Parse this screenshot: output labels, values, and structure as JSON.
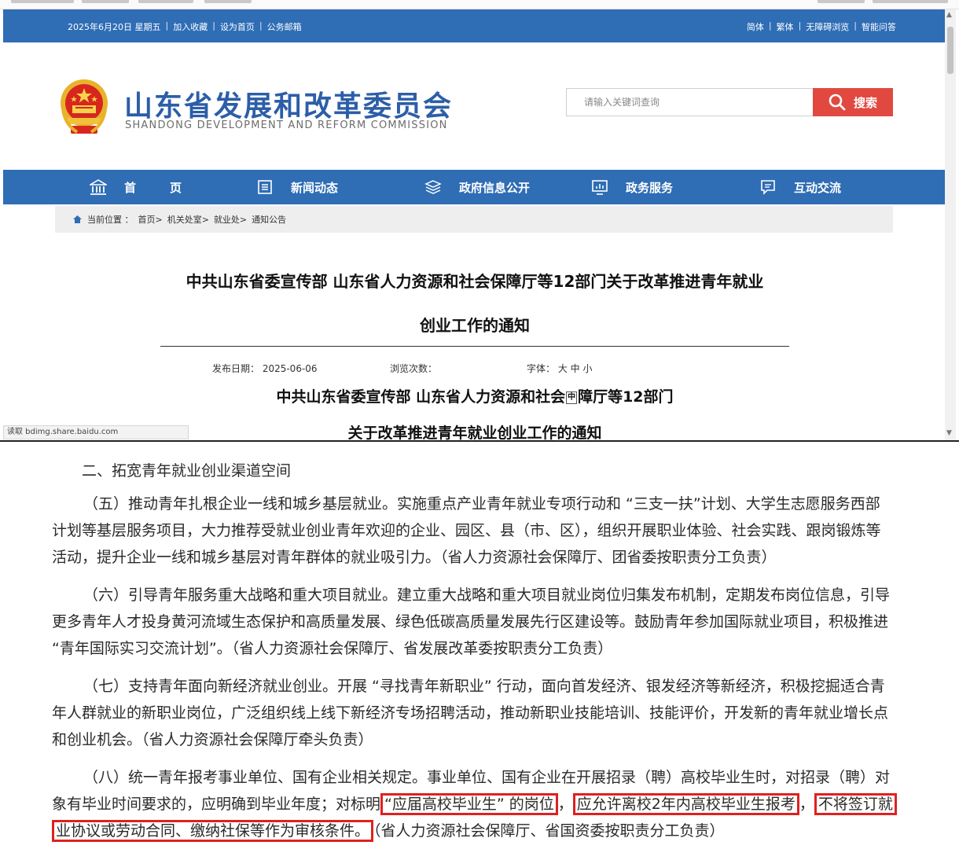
{
  "topbar": {
    "date": "2025年6月20日 星期五",
    "links_left": [
      "加入收藏",
      "设为首页",
      "公务邮箱"
    ],
    "links_right": [
      "简体",
      "繁体",
      "无障碍浏览",
      "智能问答"
    ]
  },
  "header": {
    "title": "山东省发展和改革委员会",
    "subtitle": "SHANDONG DEVELOPMENT AND REFORM COMMISSION",
    "search_placeholder": "请输入关键词查询",
    "search_button": "搜索"
  },
  "nav": {
    "items": [
      {
        "label": "首　页",
        "icon": "bank-icon"
      },
      {
        "label": "新闻动态",
        "icon": "news-icon"
      },
      {
        "label": "政府信息公开",
        "icon": "layers-icon"
      },
      {
        "label": "政务服务",
        "icon": "monitor-icon"
      },
      {
        "label": "互动交流",
        "icon": "chat-icon"
      }
    ]
  },
  "breadcrumb": {
    "prefix": "当前位置 ：",
    "items": [
      "首页>",
      "机关处室>",
      "就业处>",
      "通知公告"
    ]
  },
  "article": {
    "title_line1": "中共山东省委宣传部 山东省人力资源和社会保障厅等12部门关于改革推进青年就业",
    "title_line2": "创业工作的通知",
    "publish_date": "发布日期：  2025-06-06",
    "view_count": "浏览次数：",
    "font_size": "字体：  大 中 小",
    "sub_title_line1": "中共山东省委宣传部  山东省人力资源和社会",
    "sub_title_line1_tail": "障厅等12部门",
    "sub_title_line2": "关于改革推进青年就业创业工作的通知"
  },
  "statusbar": {
    "text": "读取 bdimg.share.baidu.com"
  },
  "content": {
    "section_heading": "二、拓宽青年就业创业渠道空间",
    "p5": [
      "（五）推动青年扎根企业一线和城乡基层就业。实施重点产业青年就业专项行动和 “三支一扶”计划、大学生志愿服务西部",
      "计划等基层服务项目，大力推荐受就业创业青年欢迎的企业、园区、县（市、区），组织开展职业体验、社会实践、跟岗锻炼等",
      "活动，提升企业一线和城乡基层对青年群体的就业吸引力。（省人力资源社会保障厅、团省委按职责分工负责）"
    ],
    "p6": [
      "（六）引导青年服务重大战略和重大项目就业。建立重大战略和重大项目就业岗位归集发布机制，定期发布岗位信息，引导",
      "更多青年人才投身黄河流域生态保护和高质量发展、绿色低碳高质量发展先行区建设等。鼓励青年参加国际就业项目，积极推进",
      "“青年国际实习交流计划”。（省人力资源社会保障厅、省发展改革委按职责分工负责）"
    ],
    "p7": [
      "（七）支持青年面向新经济就业创业。开展 “寻找青年新职业” 行动，面向首发经济、银发经济等新经济，积极挖掘适合青",
      "年人群就业的新职业岗位，广泛组织线上线下新经济专场招聘活动，推动新职业技能培训、技能评价，开发新的青年就业增长点",
      "和创业机会。（省人力资源社会保障厅牵头负责）"
    ],
    "p8": {
      "line1": "（八）统一青年报考事业单位、国有企业相关规定。事业单位、国有企业在开展招录（聘）高校毕业生时，对招录（聘）对",
      "line2_a": "象有毕业时间要求的，应明确到毕业年度；对标明",
      "line2_hl1": "“应届高校毕业生” 的岗位",
      "line2_b": "，",
      "line2_hl2": "应允许离校2年内高校毕业生报考",
      "line2_c": "，",
      "line2_hl3": "不将签订就",
      "line3_hl": "业协议或劳动合同、缴纳社保等作为审核条件。",
      "line3_tail": "（省人力资源社会保障厅、省国资委按职责分工负责）"
    }
  },
  "colors": {
    "brand_blue": "#2f6db5",
    "title_blue": "#2c5ea8",
    "search_red": "#e14940",
    "highlight_red": "#e02020"
  }
}
